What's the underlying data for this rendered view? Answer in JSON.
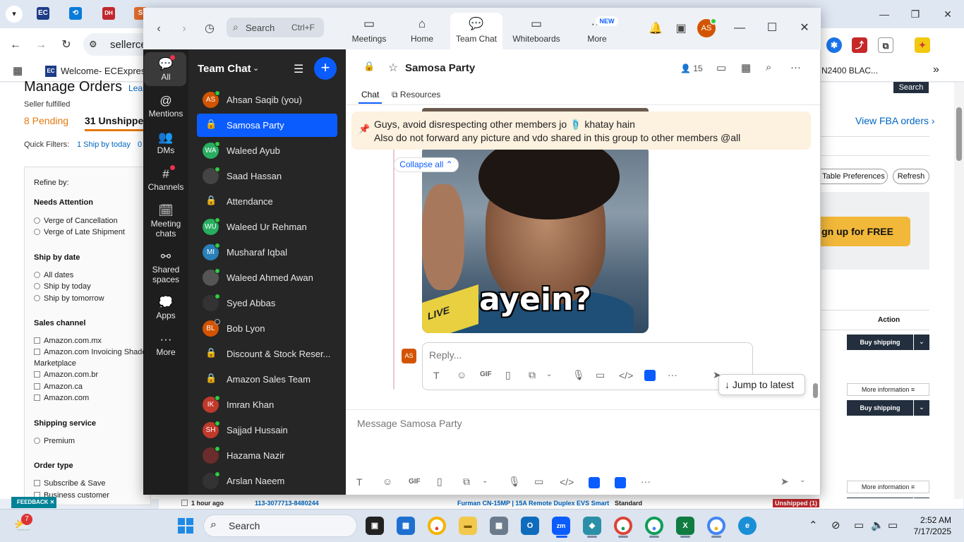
{
  "browser": {
    "address_text": "sellerce",
    "bookmark_title": "Welcome- ECExpres...",
    "bookmark_right": "N2400 BLAC...",
    "tab_icons": [
      "EC",
      "DH"
    ]
  },
  "seller_page": {
    "title": "Manage Orders",
    "learn": "Lear",
    "subtitle": "Seller fulfilled",
    "pending": "8 Pending",
    "unshipped": "31 Unshipped",
    "quick_filters_label": "Quick Filters:",
    "quick_filter_1": "1 Ship by today",
    "quick_filter_2": "0",
    "refine": "Refine by:",
    "needs_attention": "Needs Attention",
    "verge_cancel": "Verge of Cancellation",
    "verge_late": "Verge of Late Shipment",
    "ship_by_date": "Ship by date",
    "all_dates": "All dates",
    "ship_today": "Ship by today",
    "ship_tomorrow": "Ship by tomorrow",
    "sales_channel": "Sales channel",
    "ch_mx": "Amazon.com.mx",
    "ch_invoicing": "Amazon.com Invoicing Shado",
    "ch_marketplace": "Marketplace",
    "ch_br": "Amazon.com.br",
    "ch_ca": "Amazon.ca",
    "ch_com": "Amazon.com",
    "shipping_service": "Shipping service",
    "premium": "Premium",
    "order_type": "Order type",
    "subscribe_save": "Subscribe & Save",
    "business_customer": "Business customer",
    "search_btn": "Search",
    "view_fba": "View FBA orders ›",
    "table_prefs": "t Table Preferences",
    "refresh": "Refresh",
    "signup": "gn up for FREE",
    "action": "Action",
    "buy_shipping": "Buy shipping",
    "more_info": "More information ≡",
    "row_time": "1 hour ago",
    "row_order": "113-3077713-8480244",
    "row_product": "Furman CN-15MP | 15A Remote Duplex EVS Smart",
    "row_service": "Standard",
    "row_status": "Unshipped (1)",
    "feedback": "FEEDBACK ✕"
  },
  "zoom": {
    "search_label": "Search",
    "search_shortcut": "Ctrl+F",
    "tabs": [
      {
        "label": "Meetings",
        "icon": "camera-icon"
      },
      {
        "label": "Home",
        "icon": "home-icon"
      },
      {
        "label": "Team Chat",
        "icon": "chat-icon"
      },
      {
        "label": "Whiteboards",
        "icon": "whiteboard-icon"
      },
      {
        "label": "More",
        "icon": "more-icon"
      }
    ],
    "new_badge": "NEW",
    "avatar_initials": "AS",
    "rail": [
      {
        "label": "All"
      },
      {
        "label": "Mentions"
      },
      {
        "label": "DMs"
      },
      {
        "label": "Channels"
      },
      {
        "label": "Meeting chats"
      },
      {
        "label": "Shared spaces"
      },
      {
        "label": "Apps"
      },
      {
        "label": "More"
      }
    ],
    "list_title": "Team Chat",
    "chats": [
      {
        "name": "Ahsan Saqib (you)",
        "initials": "AS",
        "color": "#d35400",
        "type": "user",
        "online": true
      },
      {
        "name": "Samosa Party",
        "initials": "",
        "color": "",
        "type": "channel",
        "online": false
      },
      {
        "name": "Waleed Ayub",
        "initials": "WA",
        "color": "#27ae60",
        "type": "user",
        "online": true
      },
      {
        "name": "Saad Hassan",
        "initials": "",
        "color": "#444444",
        "type": "photo",
        "online": true
      },
      {
        "name": "Attendance",
        "initials": "",
        "color": "",
        "type": "channel",
        "online": false
      },
      {
        "name": "Waleed Ur Rehman",
        "initials": "WU",
        "color": "#27ae60",
        "type": "user",
        "online": true
      },
      {
        "name": "Musharaf Iqbal",
        "initials": "MI",
        "color": "#2980b9",
        "type": "user",
        "online": true
      },
      {
        "name": "Waleed Ahmed Awan",
        "initials": "",
        "color": "#555555",
        "type": "photo",
        "online": true
      },
      {
        "name": "Syed Abbas",
        "initials": "",
        "color": "#333333",
        "type": "photo",
        "online": true
      },
      {
        "name": "Bob Lyon",
        "initials": "BL",
        "color": "#d35400",
        "type": "user",
        "online": false
      },
      {
        "name": "Discount & Stock Reser...",
        "initials": "",
        "color": "",
        "type": "channel",
        "online": false
      },
      {
        "name": "Amazon Sales Team",
        "initials": "",
        "color": "",
        "type": "channel",
        "online": false
      },
      {
        "name": "Imran Khan",
        "initials": "IK",
        "color": "#c0392b",
        "type": "user",
        "online": true
      },
      {
        "name": "Sajjad Hussain",
        "initials": "SH",
        "color": "#c0392b",
        "type": "user",
        "online": true
      },
      {
        "name": "Hazama Nazir",
        "initials": "",
        "color": "#6b2c2c",
        "type": "photo",
        "online": true
      },
      {
        "name": "Arslan Naeem",
        "initials": "",
        "color": "#333333",
        "type": "photo",
        "online": true
      }
    ],
    "channel_title": "Samosa Party",
    "member_count": "15",
    "subtab_chat": "Chat",
    "subtab_resources": "Resources",
    "pinned_line1": "Guys, avoid disrespecting other members jo 🩴 khatay hain",
    "pinned_line2": "Also do not forward any picture and vdo shared in this group to other members @all",
    "collapse_all": "Collapse all ⌃",
    "meme_caption": "ayein?",
    "meme_sign": "LIVE",
    "reply_avatar": "AS",
    "reply_placeholder": "Reply...",
    "gif_label": "GIF",
    "jump_latest": "Jump to latest",
    "composer_placeholder": "Message Samosa Party"
  },
  "taskbar": {
    "search_label": "Search",
    "weather_badge": "7",
    "time": "2:52 AM",
    "date": "7/17/2025"
  },
  "colors": {
    "zoom_blue": "#0b5cff",
    "rail_bg": "#1e1e1e",
    "list_bg": "#262626",
    "pin_bg": "#fdf1df",
    "amazon_orange": "#e47911"
  }
}
